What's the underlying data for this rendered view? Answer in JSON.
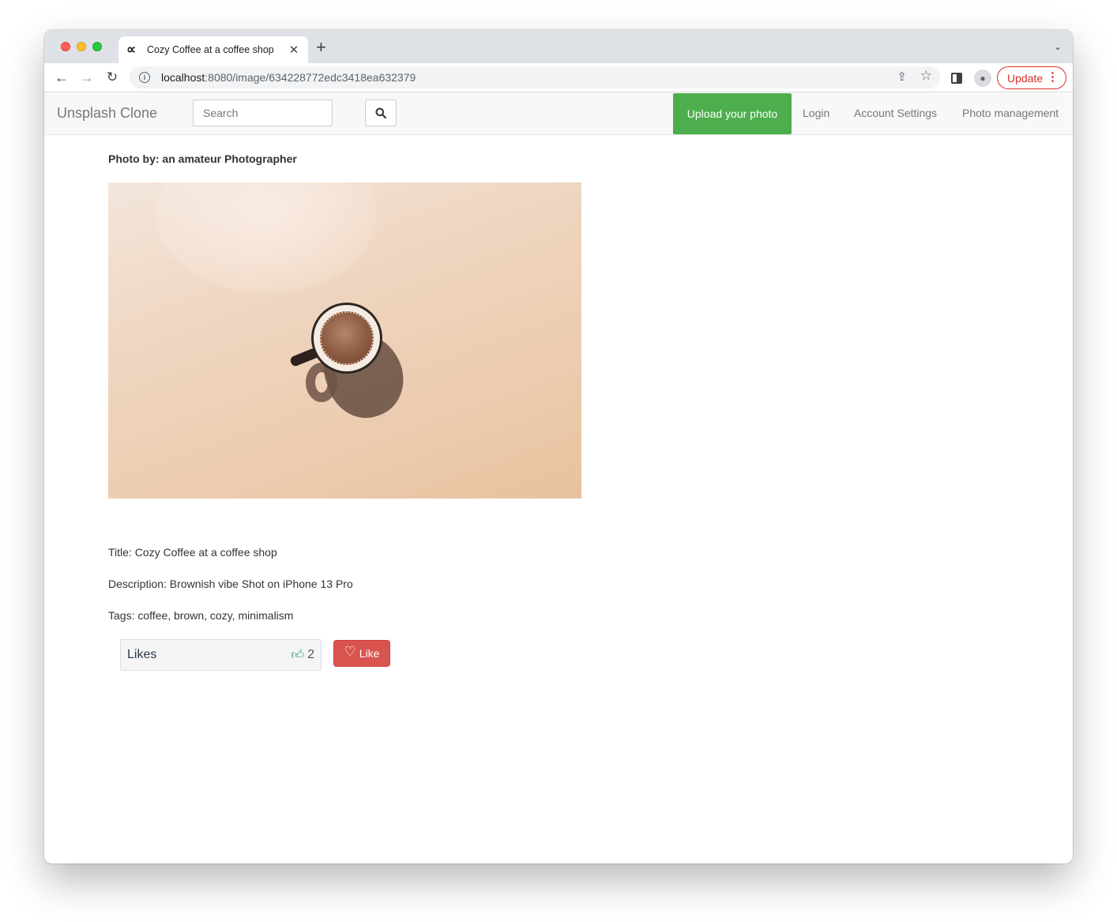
{
  "browser": {
    "tab_title": "Cozy Coffee at a coffee shop",
    "tab_favicon_icon": "infinity-icon",
    "url_host": "localhost",
    "url_path": ":8080/image/634228772edc3418ea632379",
    "update_label": "Update"
  },
  "navbar": {
    "brand": "Unsplash Clone",
    "search_placeholder": "Search",
    "upload_label": "Upload your photo",
    "login_label": "Login",
    "account_label": "Account Settings",
    "photos_label": "Photo management",
    "accent_color": "#4cae4c"
  },
  "photo": {
    "photo_by": "Photo by: an amateur Photographer",
    "title_line": "Title: Cozy Coffee at a coffee shop",
    "description_line": "Description: Brownish vibe Shot on iPhone 13 Pro",
    "tags_line": "Tags: coffee, brown, cozy, minimalism"
  },
  "likes": {
    "label": "Likes",
    "count": "2",
    "like_button_label": "Like",
    "like_button_color": "#d9534f"
  }
}
